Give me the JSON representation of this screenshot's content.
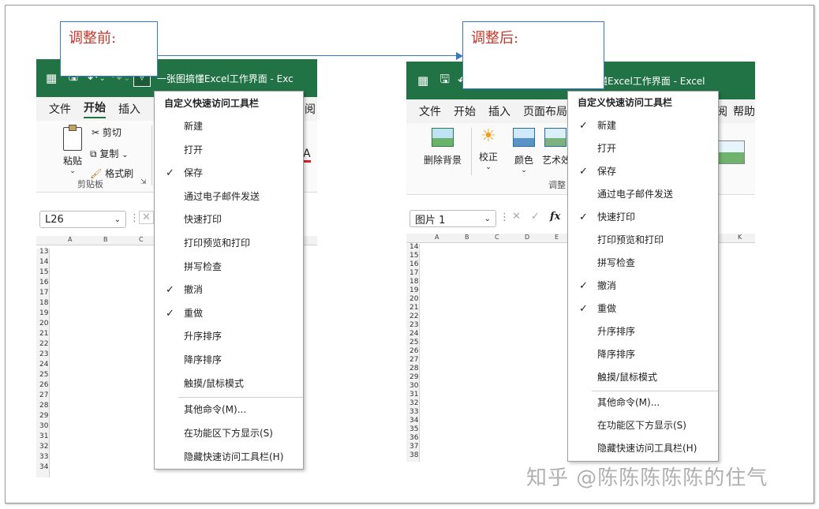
{
  "callouts": {
    "before": "调整前:",
    "after": "调整后:"
  },
  "window_title": "一张图搞懂Excel工作界面 - Excel",
  "window_title_truncated": "一张图搞懂Excel工作界面 - Exc",
  "left": {
    "tabs": [
      "文件",
      "开始",
      "插入",
      "阅"
    ],
    "ribbon": {
      "paste": "粘贴",
      "cut": "剪切",
      "copy": "复制",
      "format_painter": "格式刷",
      "group_label": "剪贴板",
      "font_a": "A"
    },
    "namebox": "L26",
    "col_headers": [
      "A",
      "B",
      "C"
    ],
    "rows": [
      "13",
      "14",
      "15",
      "16",
      "17",
      "18",
      "19",
      "20",
      "21",
      "22",
      "23",
      "24",
      "25",
      "26",
      "27",
      "28",
      "29",
      "30",
      "31",
      "32",
      "33",
      "34"
    ]
  },
  "right": {
    "tabs": [
      "文件",
      "开始",
      "插入",
      "页面布局",
      "阅",
      "帮助"
    ],
    "ribbon": {
      "remove_bg": "删除背景",
      "corrections": "校正",
      "color": "颜色",
      "artistic": "艺术效",
      "group_label": "调整"
    },
    "namebox": "图片 1",
    "fx": "fx",
    "col_headers": [
      "A",
      "B",
      "C",
      "D",
      "E",
      "K"
    ],
    "rows": [
      "14",
      "15",
      "16",
      "17",
      "18",
      "19",
      "20",
      "21",
      "22",
      "23",
      "24",
      "25",
      "26",
      "27",
      "28",
      "29",
      "30",
      "31",
      "32",
      "33",
      "34",
      "35",
      "36",
      "37",
      "38"
    ]
  },
  "menu": {
    "title": "自定义快速访问工具栏",
    "items_before": [
      {
        "label": "新建",
        "checked": false
      },
      {
        "label": "打开",
        "checked": false
      },
      {
        "label": "保存",
        "checked": true
      },
      {
        "label": "通过电子邮件发送",
        "checked": false
      },
      {
        "label": "快速打印",
        "checked": false
      },
      {
        "label": "打印预览和打印",
        "checked": false
      },
      {
        "label": "拼写检查",
        "checked": false
      },
      {
        "label": "撤消",
        "checked": true
      },
      {
        "label": "重做",
        "checked": true
      },
      {
        "label": "升序排序",
        "checked": false
      },
      {
        "label": "降序排序",
        "checked": false
      },
      {
        "label": "触摸/鼠标模式",
        "checked": false
      }
    ],
    "items_after": [
      {
        "label": "新建",
        "checked": true
      },
      {
        "label": "打开",
        "checked": false
      },
      {
        "label": "保存",
        "checked": true
      },
      {
        "label": "通过电子邮件发送",
        "checked": false
      },
      {
        "label": "快速打印",
        "checked": true
      },
      {
        "label": "打印预览和打印",
        "checked": false
      },
      {
        "label": "拼写检查",
        "checked": false
      },
      {
        "label": "撤消",
        "checked": true
      },
      {
        "label": "重做",
        "checked": true
      },
      {
        "label": "升序排序",
        "checked": false
      },
      {
        "label": "降序排序",
        "checked": false
      },
      {
        "label": "触摸/鼠标模式",
        "checked": false
      }
    ],
    "more_commands": "其他命令(M)...",
    "show_below": "在功能区下方显示(S)",
    "hide_qat": "隐藏快速访问工具栏(H)"
  },
  "watermark": "知乎 @陈陈陈陈陈的住气",
  "colors": {
    "excel_green": "#217346",
    "callout_border": "#3a78c4",
    "callout_text": "#c0392b"
  }
}
